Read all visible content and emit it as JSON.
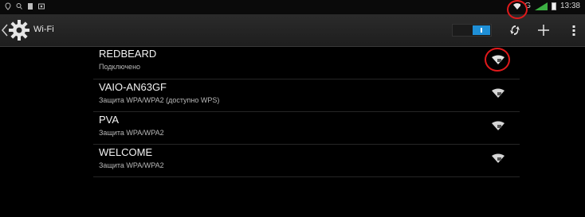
{
  "status_bar": {
    "time": "13:38",
    "network_label": "G",
    "left_icons": [
      "location-icon",
      "search-icon",
      "notification-icon",
      "screenshot-icon"
    ]
  },
  "action_bar": {
    "title": "Wi-Fi",
    "toggle_state": "on",
    "icons": [
      "settings-gear-icon",
      "wps-icon",
      "add-icon",
      "overflow-menu-icon"
    ]
  },
  "networks": [
    {
      "ssid": "REDBEARD",
      "status": "Подключено"
    },
    {
      "ssid": "VAIO-AN63GF",
      "status": "Защита WPA/WPA2 (доступно WPS)"
    },
    {
      "ssid": "PVA",
      "status": "Защита WPA/WPA2"
    },
    {
      "ssid": "WELCOME",
      "status": "Защита WPA/WPA2"
    }
  ],
  "colors": {
    "accent": "#1f8fd6",
    "highlight_ring": "#e0191b",
    "background": "#000000"
  }
}
